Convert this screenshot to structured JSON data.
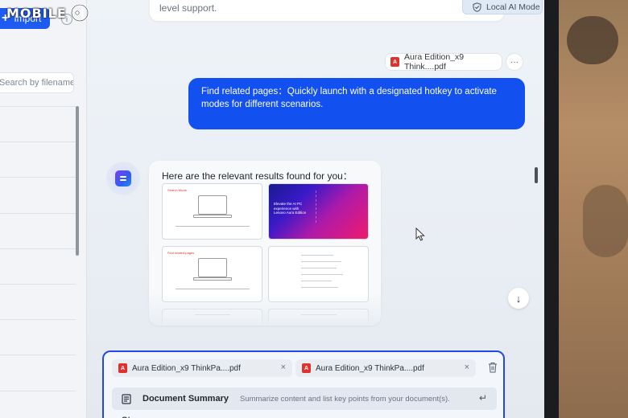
{
  "logo": {
    "text": "MOBILE"
  },
  "sidebar": {
    "import_label": "Import",
    "info_icon": "i",
    "search_placeholder": "Search by filename"
  },
  "header": {
    "top_bubble_text": "level support.",
    "ai_mode_label": "Local AI Mode"
  },
  "chat": {
    "user_file": {
      "name": "Aura Edition_x9 Think....pdf",
      "more": "···"
    },
    "user_message": "Find related pages：Quickly launch with a designated hotkey to activate modes for different scenarios.",
    "assistant_message": "Here are the relevant results found for you：",
    "thumbnails": [
      {
        "kind": "page",
        "title": "Search Mode"
      },
      {
        "kind": "promo",
        "title": "Elevate the AI PC experience with Lenovo Aura Edition"
      },
      {
        "kind": "page",
        "title": "Find related pages"
      },
      {
        "kind": "text"
      },
      {
        "kind": "text"
      },
      {
        "kind": "text"
      }
    ],
    "down_arrow": "↓"
  },
  "composer": {
    "attachments": [
      {
        "name": "Aura Edition_x9 ThinkPa....pdf",
        "close": "×"
      },
      {
        "name": "Aura Edition_x9 ThinkPa....pdf",
        "close": "×"
      }
    ],
    "suggestion": {
      "title": "Document Summary",
      "description": "Summarize content and list key points from your document(s).",
      "enter_symbol": "↵"
    },
    "next_item_initial": "St"
  },
  "colors": {
    "accent": "#1251f0",
    "pdf_red": "#e0312f",
    "composer_border": "#2448e8"
  }
}
